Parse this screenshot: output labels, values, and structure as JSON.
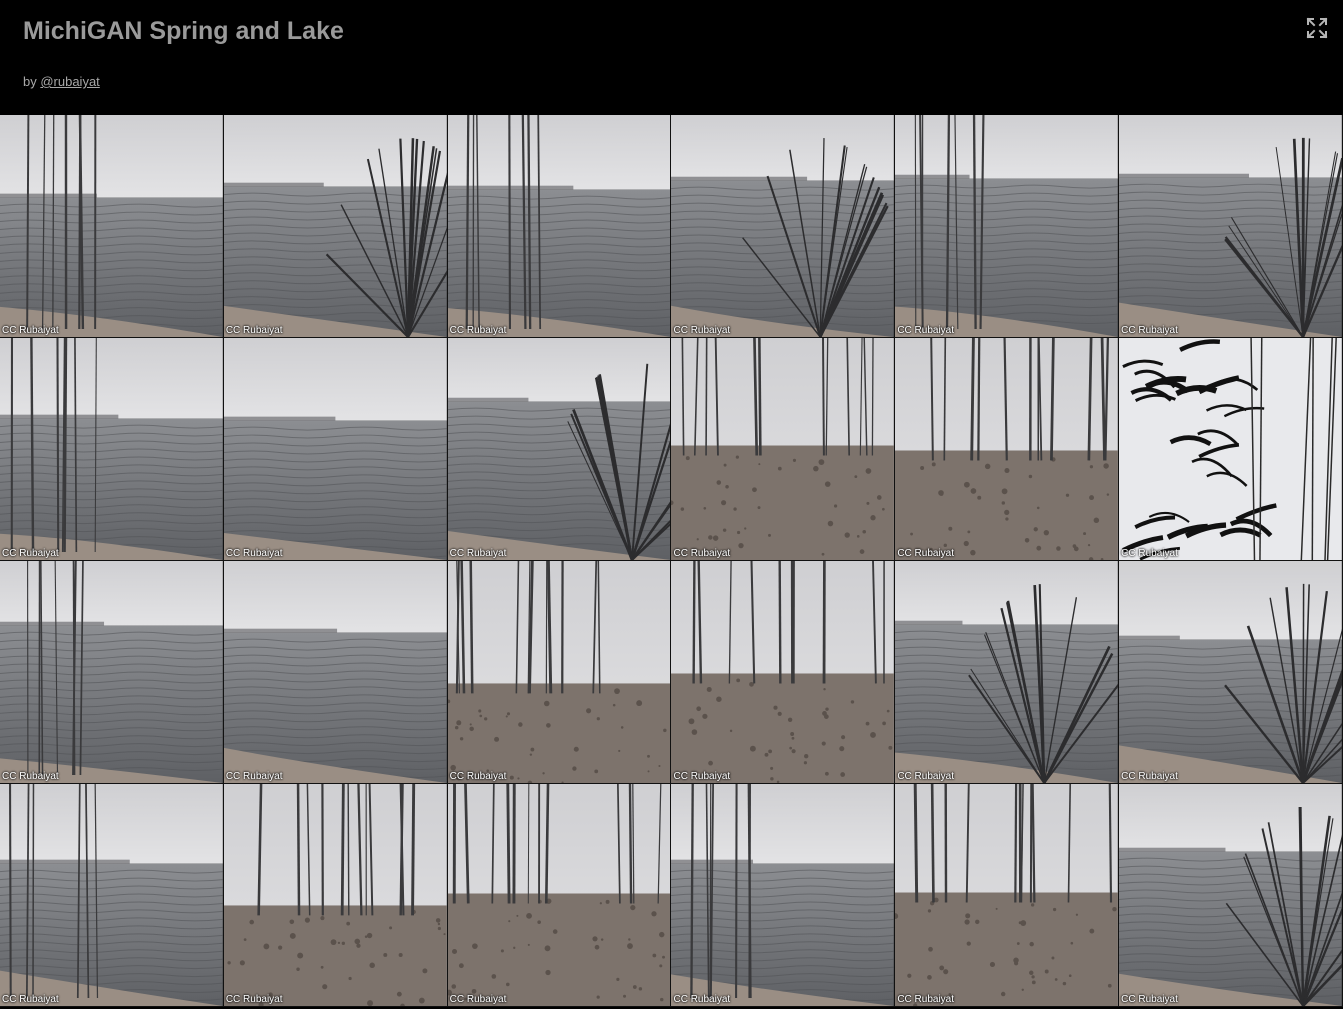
{
  "header": {
    "title": "MichiGAN Spring and Lake",
    "by_prefix": "by ",
    "author_link": "@rubaiyat"
  },
  "icons": {
    "fullscreen": "fullscreen-expand-icon"
  },
  "colors": {
    "background": "#000000",
    "title": "#9a9a9a",
    "sky": "#d8d8da",
    "water": "#6e7074",
    "sand": "#8a7d72"
  },
  "tiles": [
    {
      "credit": "CC Rubaiyat",
      "scene": "lake-left-trees"
    },
    {
      "credit": "CC Rubaiyat",
      "scene": "lake-right-tree"
    },
    {
      "credit": "CC Rubaiyat",
      "scene": "lake-shore"
    },
    {
      "credit": "CC Rubaiyat",
      "scene": "lake-big-tree"
    },
    {
      "credit": "CC Rubaiyat",
      "scene": "lake-left-trees"
    },
    {
      "credit": "CC Rubaiyat",
      "scene": "lake-right-tree"
    },
    {
      "credit": "CC Rubaiyat",
      "scene": "lake-left-trees"
    },
    {
      "credit": "CC Rubaiyat",
      "scene": "lake-open"
    },
    {
      "credit": "CC Rubaiyat",
      "scene": "lake-right-tree"
    },
    {
      "credit": "CC Rubaiyat",
      "scene": "forest-ground"
    },
    {
      "credit": "CC Rubaiyat",
      "scene": "forest-ground"
    },
    {
      "credit": "CC Rubaiyat",
      "scene": "abstract-branches"
    },
    {
      "credit": "CC Rubaiyat",
      "scene": "lake-left-trees"
    },
    {
      "credit": "CC Rubaiyat",
      "scene": "lake-open"
    },
    {
      "credit": "CC Rubaiyat",
      "scene": "forest-ground"
    },
    {
      "credit": "CC Rubaiyat",
      "scene": "forest-ground"
    },
    {
      "credit": "CC Rubaiyat",
      "scene": "lake-big-tree"
    },
    {
      "credit": "CC Rubaiyat",
      "scene": "lake-right-tree"
    },
    {
      "credit": "CC Rubaiyat",
      "scene": "lake-left-trees"
    },
    {
      "credit": "CC Rubaiyat",
      "scene": "forest-ground"
    },
    {
      "credit": "CC Rubaiyat",
      "scene": "forest-ground"
    },
    {
      "credit": "CC Rubaiyat",
      "scene": "lake-left-trees"
    },
    {
      "credit": "CC Rubaiyat",
      "scene": "forest-ground"
    },
    {
      "credit": "CC Rubaiyat",
      "scene": "lake-right-tree"
    }
  ]
}
